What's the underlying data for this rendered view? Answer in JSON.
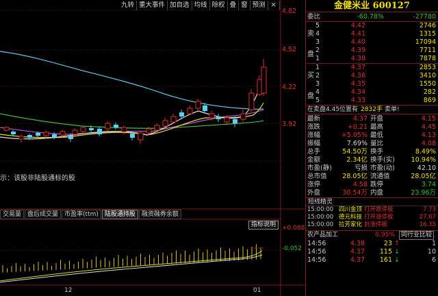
{
  "toolbar": {
    "buttons": [
      "九转",
      "重大事件",
      "加自选",
      "均线",
      "除权",
      "叠",
      "窗",
      "预测"
    ],
    "close": "✕"
  },
  "chart": {
    "price_labels": [
      "4.82",
      "4.52",
      "4.22",
      "3.92"
    ],
    "notice": "示：该股非陆股通标的股",
    "indicator_tabs": [
      "交易量",
      "盘后成交量",
      "市盈率(ttm)",
      "陆股通持股",
      "融资融券余额"
    ],
    "indicator_active": 3,
    "indicator_legend_btn": "指标说明",
    "indicator_values": [
      "+0.088",
      "-0.052"
    ],
    "date_labels": [
      "12",
      "01"
    ]
  },
  "panel": {
    "title": "金健米业 600127",
    "weibi": {
      "label": "委比",
      "pct": "-60.78%",
      "diff": "-27780"
    },
    "sell_label": [
      "卖",
      "盘"
    ],
    "buy_label": [
      "买",
      "盘"
    ],
    "sells": [
      {
        "lvl": "5",
        "price": "4.42",
        "vol": "2746"
      },
      {
        "lvl": "4",
        "price": "4.41",
        "vol": "1315"
      },
      {
        "lvl": "3",
        "price": "4.40",
        "vol": "17094"
      },
      {
        "lvl": "2",
        "price": "4.39",
        "vol": "7711"
      },
      {
        "lvl": "1",
        "price": "4.38",
        "vol": "7878"
      }
    ],
    "buys": [
      {
        "lvl": "1",
        "price": "4.37",
        "vol": "2853"
      },
      {
        "lvl": "2",
        "price": "4.36",
        "vol": "3410"
      },
      {
        "lvl": "3",
        "price": "4.35",
        "vol": "1550"
      },
      {
        "lvl": "4",
        "price": "4.34",
        "vol": "282"
      },
      {
        "lvl": "5",
        "price": "4.33",
        "vol": "869"
      }
    ],
    "inner": {
      "text": "在卖盘4.45位置有",
      "vol": "2832手",
      "action": "卖单!"
    },
    "stats": [
      {
        "l1": "最新",
        "v1": "4.37",
        "c1": "c-red",
        "l2": "开盘",
        "v2": "4.15",
        "c2": "c-red"
      },
      {
        "l1": "涨跌",
        "v1": "+0.21",
        "c1": "c-red",
        "l2": "最高",
        "v2": "4.45",
        "c2": "c-red"
      },
      {
        "l1": "涨幅",
        "v1": "+5.05%",
        "c1": "c-red",
        "l2": "最低",
        "v2": "4.13",
        "c2": "c-red"
      },
      {
        "l1": "振幅",
        "v1": "7.69%",
        "c1": "c-white",
        "l2": "量比",
        "v2": "4.08",
        "c2": "c-red"
      },
      {
        "l1": "总手",
        "v1": "54.50万",
        "c1": "c-yellow",
        "l2": "换手",
        "v2": "8.49%",
        "c2": "c-yellow"
      },
      {
        "l1": "金额",
        "v1": "2.34亿",
        "c1": "c-yellow",
        "l2": "换手(实)",
        "v2": "10.94%",
        "c2": "c-yellow"
      },
      {
        "l1": "市盈(静)",
        "v1": "亏损",
        "c1": "c-white",
        "l2": "市盈(动)",
        "v2": "42.10",
        "c2": "c-white"
      },
      {
        "l1": "总市值",
        "v1": "28.05亿",
        "c1": "c-yellow",
        "l2": "流通值",
        "v2": "28.05亿",
        "c2": "c-yellow"
      },
      {
        "l1": "涨停",
        "v1": "4.58",
        "c1": "c-red",
        "l2": "跌停",
        "v2": "3.74",
        "c2": "c-green"
      },
      {
        "l1": "外盘",
        "v1": "30.54万",
        "c1": "c-red",
        "l2": "内盘",
        "v2": "23.96万",
        "c2": "c-green"
      }
    ],
    "wizard_title": "短线精灵",
    "wizard": [
      {
        "time": "15:00:00",
        "stock": "四川金顶",
        "event": "打开跌停板",
        "val": "7.73"
      },
      {
        "time": "15:00:00",
        "stock": "德元科技",
        "event": "打开涨停板",
        "val": "27.67"
      },
      {
        "time": "15:00:00",
        "stock": "拉芳家化",
        "event": "封涨停板",
        "val": "16.35"
      }
    ],
    "industry": {
      "name": "农产品加工",
      "pct": "0.95%",
      "btn": "同行业比较"
    },
    "ticks": [
      {
        "time": "14:56",
        "price": "4.38",
        "vol": "23",
        "arr": "↑",
        "n": "1"
      },
      {
        "time": "14:56",
        "price": "4.37",
        "vol": "115",
        "arr": "↓",
        "n": "10"
      },
      {
        "time": "14:56",
        "price": "4.37",
        "vol": "161",
        "arr": "↓",
        "n": "6"
      }
    ]
  }
}
